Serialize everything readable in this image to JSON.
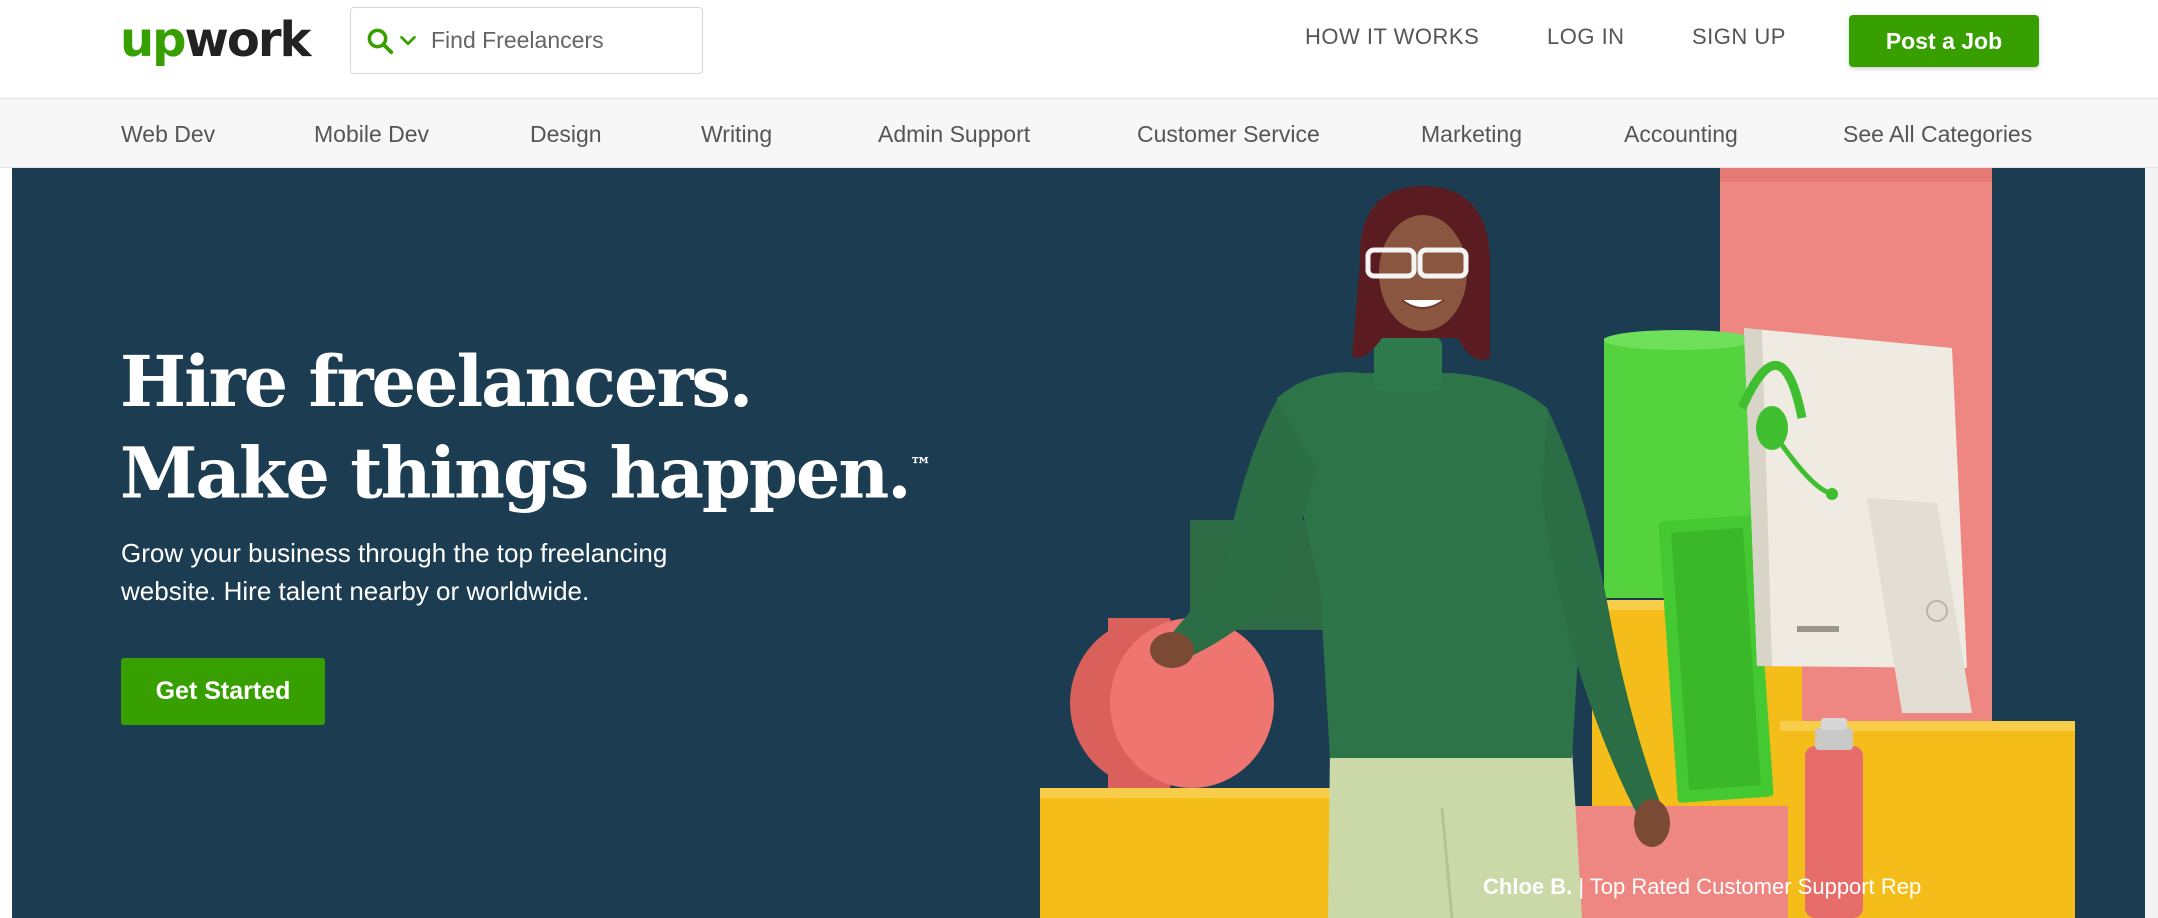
{
  "header": {
    "logo": {
      "part1": "up",
      "part2": "work"
    },
    "search": {
      "icon": "search-icon",
      "dropdown_icon": "chevron-down-icon",
      "placeholder": "Find Freelancers"
    },
    "nav": {
      "how_it_works": "HOW IT WORKS",
      "log_in": "LOG IN",
      "sign_up": "SIGN UP"
    },
    "post_job": "Post a Job"
  },
  "categories": [
    "Web Dev",
    "Mobile Dev",
    "Design",
    "Writing",
    "Admin Support",
    "Customer Service",
    "Marketing",
    "Accounting",
    "See All Categories"
  ],
  "hero": {
    "headline_line1": "Hire freelancers.",
    "headline_line2": "Make things happen.",
    "trademark": "™",
    "subtext": "Grow your business through the top freelancing website. Hire talent nearby or worldwide.",
    "cta": "Get Started",
    "caption_name": "Chloe B.",
    "caption_separator": "|",
    "caption_role": "Top Rated Customer Support Rep"
  },
  "colors": {
    "brand_green": "#37a000",
    "hero_bg": "#1c3d51",
    "pink": "#ee8681",
    "yellow": "#f5bd19",
    "bright_green": "#54d33e",
    "sweater_green": "#2d7449"
  }
}
